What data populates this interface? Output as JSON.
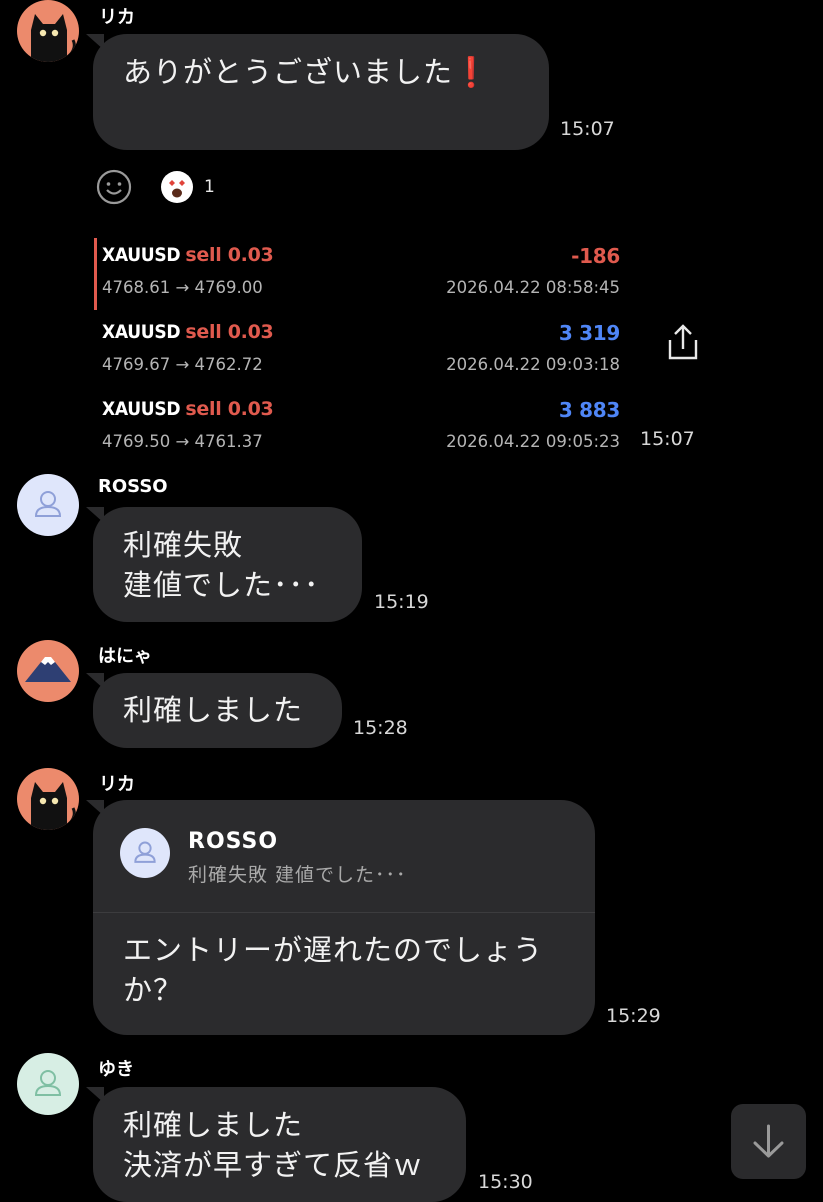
{
  "messages": [
    {
      "sender": "リカ",
      "lines": [
        "ありがとうございました❗"
      ],
      "time": "15:07"
    },
    {
      "reaction": {
        "count": "1"
      }
    },
    {
      "trades": [
        {
          "symbol": "XAUUSD",
          "side": "sell 0.03",
          "pnl": "-186",
          "prices": "4768.61 → 4769.00",
          "datetime": "2026.04.22 08:58:45"
        },
        {
          "symbol": "XAUUSD",
          "side": "sell 0.03",
          "pnl": "3 319",
          "prices": "4769.67 → 4762.72",
          "datetime": "2026.04.22 09:03:18"
        },
        {
          "symbol": "XAUUSD",
          "side": "sell 0.03",
          "pnl": "3 883",
          "prices": "4769.50 → 4761.37",
          "datetime": "2026.04.22 09:05:23"
        }
      ],
      "time": "15:07"
    },
    {
      "sender": "ROSSO",
      "lines": [
        "利確失敗",
        "建値でした･･･"
      ],
      "time": "15:19"
    },
    {
      "sender": "はにゃ",
      "lines": [
        "利確しました"
      ],
      "time": "15:28"
    },
    {
      "sender": "リカ",
      "reply": {
        "name": "ROSSO",
        "text": "利確失敗 建値でした･･･"
      },
      "lines": [
        "エントリーが遅れたのでしょう",
        "か？"
      ],
      "time": "15:29"
    },
    {
      "sender": "ゆき",
      "lines": [
        "利確しました",
        "決済が早すぎて反省ｗ"
      ],
      "time": "15:30"
    }
  ],
  "colors": {
    "background": "#000000",
    "bubble": "#2b2b2d",
    "loss": "#e05a4e",
    "profit": "#4f86f7",
    "avatar_cat_bg": "#ec8a6c",
    "avatar_default_rosso": "#dfe6fb",
    "avatar_default_yuki": "#d7eee4"
  },
  "icons": {
    "share": "share-icon",
    "add_reaction": "add-reaction-icon",
    "scroll_down": "arrow-down-icon"
  }
}
